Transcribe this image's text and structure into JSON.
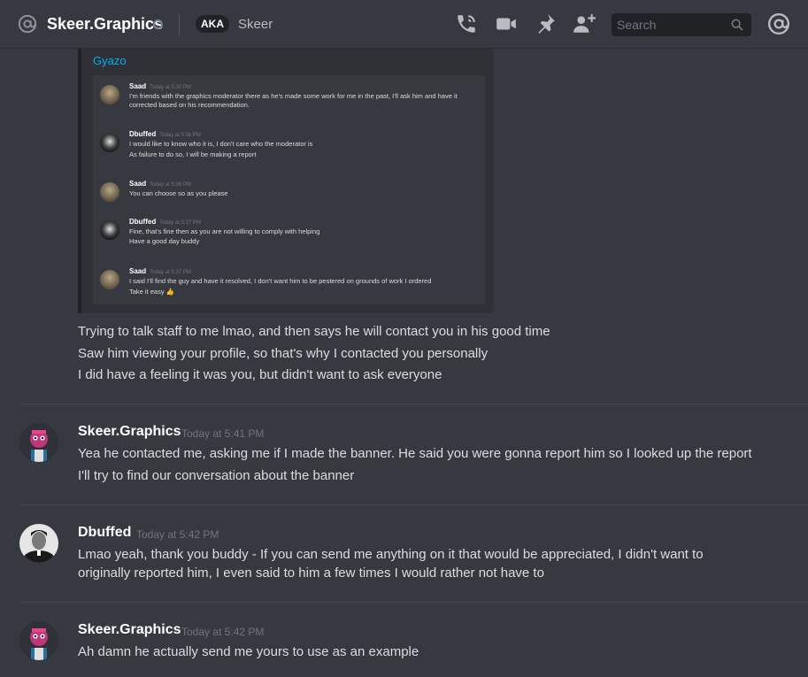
{
  "header": {
    "channel_name": "Skeer.Graphics",
    "aka_badge": "AKA",
    "aka_name": "Skeer",
    "search_placeholder": "Search"
  },
  "embed": {
    "provider": "Gyazo",
    "messages": [
      {
        "author": "Saad",
        "time": "Today at 5:30 PM",
        "lines": [
          "I'm friends with the graphics moderator there as he's made some work for me in the past, I'll ask him and have it",
          "corrected based on his recommendation."
        ]
      },
      {
        "author": "Dbuffed",
        "time": "Today at 5:36 PM",
        "lines": [
          "I would like to know who it is, I don't care who the moderator is",
          "As failure to do so, I will be making a report"
        ]
      },
      {
        "author": "Saad",
        "time": "Today at 5:36 PM",
        "lines": [
          "You can choose so as you please"
        ]
      },
      {
        "author": "Dbuffed",
        "time": "Today at 5:37 PM",
        "lines": [
          "Fine, that's fine then as you are not willing to comply with helping",
          "Have a good day buddy"
        ]
      },
      {
        "author": "Saad",
        "time": "Today at 5:37 PM",
        "lines": [
          "I said I'll find the guy and have it resolved, I don't want him to be pestered on grounds of work I ordered",
          "Take it easy 👍"
        ]
      }
    ]
  },
  "messages": [
    {
      "lines": [
        "Trying to talk staff to me lmao, and then says he will contact you in his good time",
        "Saw him viewing your profile, so that's why I contacted you personally",
        "I did have a feeling it was you, but didn't want to ask everyone"
      ]
    },
    {
      "author": "Skeer.Graphics",
      "time": "Today at 5:41 PM",
      "lines": [
        "Yea he contacted me, asking me if I made the banner. He said you were gonna report him so I looked up the report",
        "I'll try to find our conversation about the banner"
      ]
    },
    {
      "author": "Dbuffed",
      "time": "Today at 5:42 PM",
      "lines": [
        "Lmao yeah, thank you buddy - If you can send me anything on it that would be appreciated, I didn't want to",
        "originally reported him, I even said to him a few times I would rather not have to"
      ]
    },
    {
      "author": "Skeer.Graphics",
      "time": "Today at 5:42 PM",
      "lines": [
        "Ah damn he actually send me yours to use as an example"
      ]
    }
  ],
  "colors": {
    "background": "#36393f",
    "link": "#00b0f4",
    "author": "#ffffff",
    "timestamp": "#72767d"
  }
}
